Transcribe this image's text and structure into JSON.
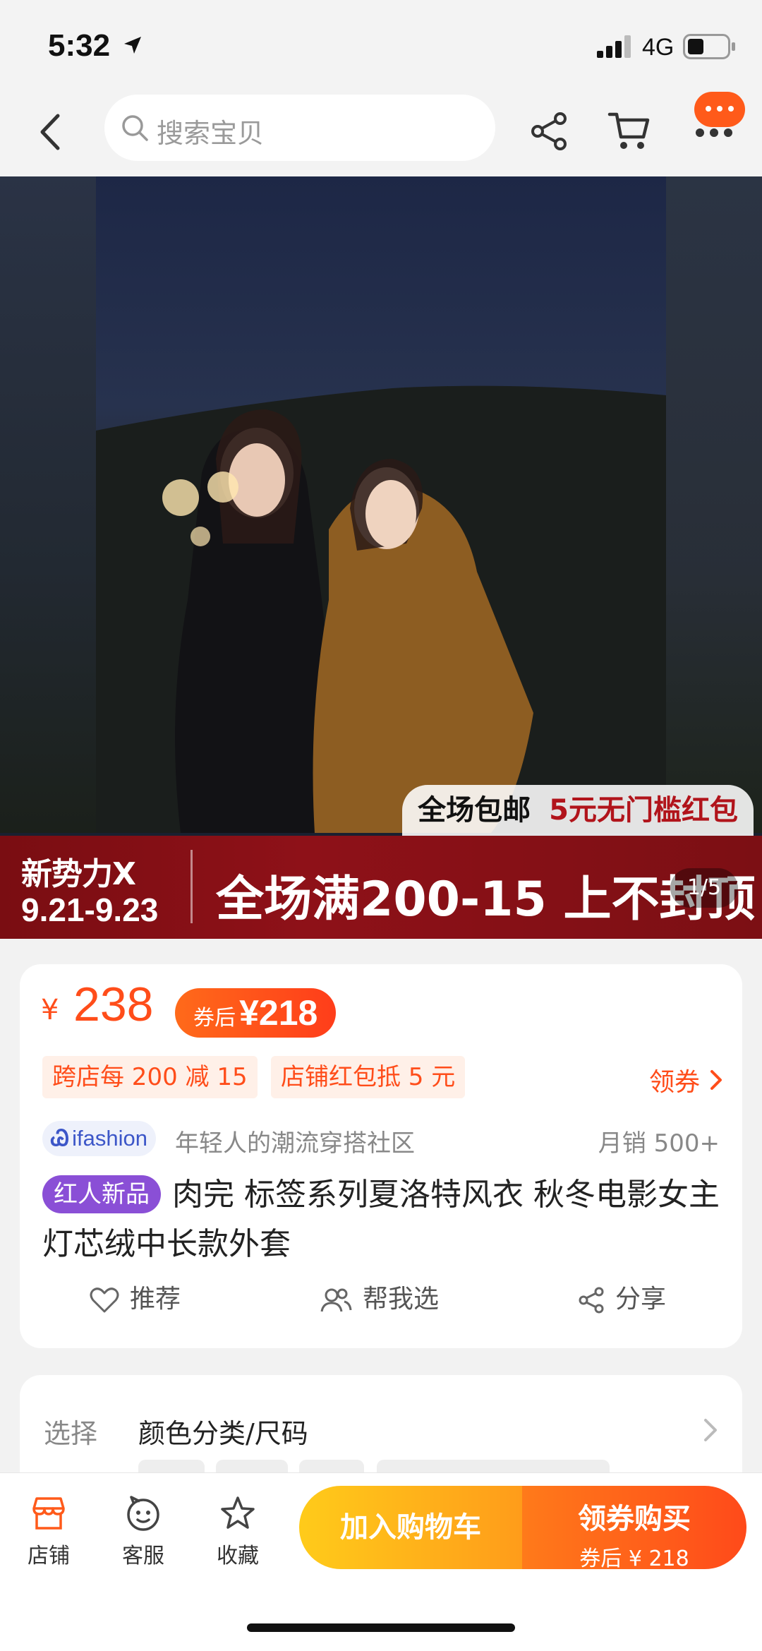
{
  "status_bar": {
    "time": "5:32",
    "network": "4G"
  },
  "header": {
    "search_placeholder": "搜索宝贝"
  },
  "hero": {
    "promo_free_shipping": "全场包邮",
    "promo_red_packet": "5元无门槛红包",
    "banner_brand": "新势力X",
    "banner_dates": "9.21-9.23",
    "banner_main": "全场满200-15 上不封顶",
    "page_indicator": "1/5"
  },
  "product": {
    "price_symbol": "¥",
    "price": "238",
    "coupon_label": "券后",
    "coupon_price": "¥218",
    "promos": [
      "跨店每 200 减 15",
      "店铺红包抵 5 元"
    ],
    "get_coupon": "领券",
    "brand_logo": "ifashion",
    "brand_tagline": "年轻人的潮流穿搭社区",
    "monthly_sales": "月销 500+",
    "new_badge": "红人新品",
    "title": "肉完 标签系列夏洛特风衣 秋冬电影女主灯芯绒中长款外套",
    "actions": {
      "recommend": "推荐",
      "help_choose": "帮我选",
      "share": "分享"
    }
  },
  "select": {
    "label": "选择",
    "value": "颜色分类/尺码"
  },
  "bottom_bar": {
    "tabs": {
      "store": "店铺",
      "service": "客服",
      "favorite": "收藏"
    },
    "add_to_cart": "加入购物车",
    "buy_title": "领券购买",
    "buy_sub": "券后 ¥ 218"
  },
  "colors": {
    "accent": "#ff4d1a",
    "cta_yellow": "#ffcb1a",
    "badge_purple": "#8a4fd6",
    "banner_red": "#8e1118"
  }
}
